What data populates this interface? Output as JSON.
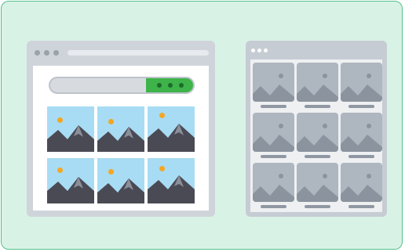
{
  "illustration": {
    "left_window": {
      "title_dots": 3,
      "thumbnail_count": 6
    },
    "right_window": {
      "title_dots": 3,
      "card_count": 9
    },
    "colors": {
      "background": "#d9f2e6",
      "border": "#54c28c",
      "search_button": "#3db34a",
      "sun": "#f5a623",
      "sky": "#a8dcf4"
    }
  }
}
